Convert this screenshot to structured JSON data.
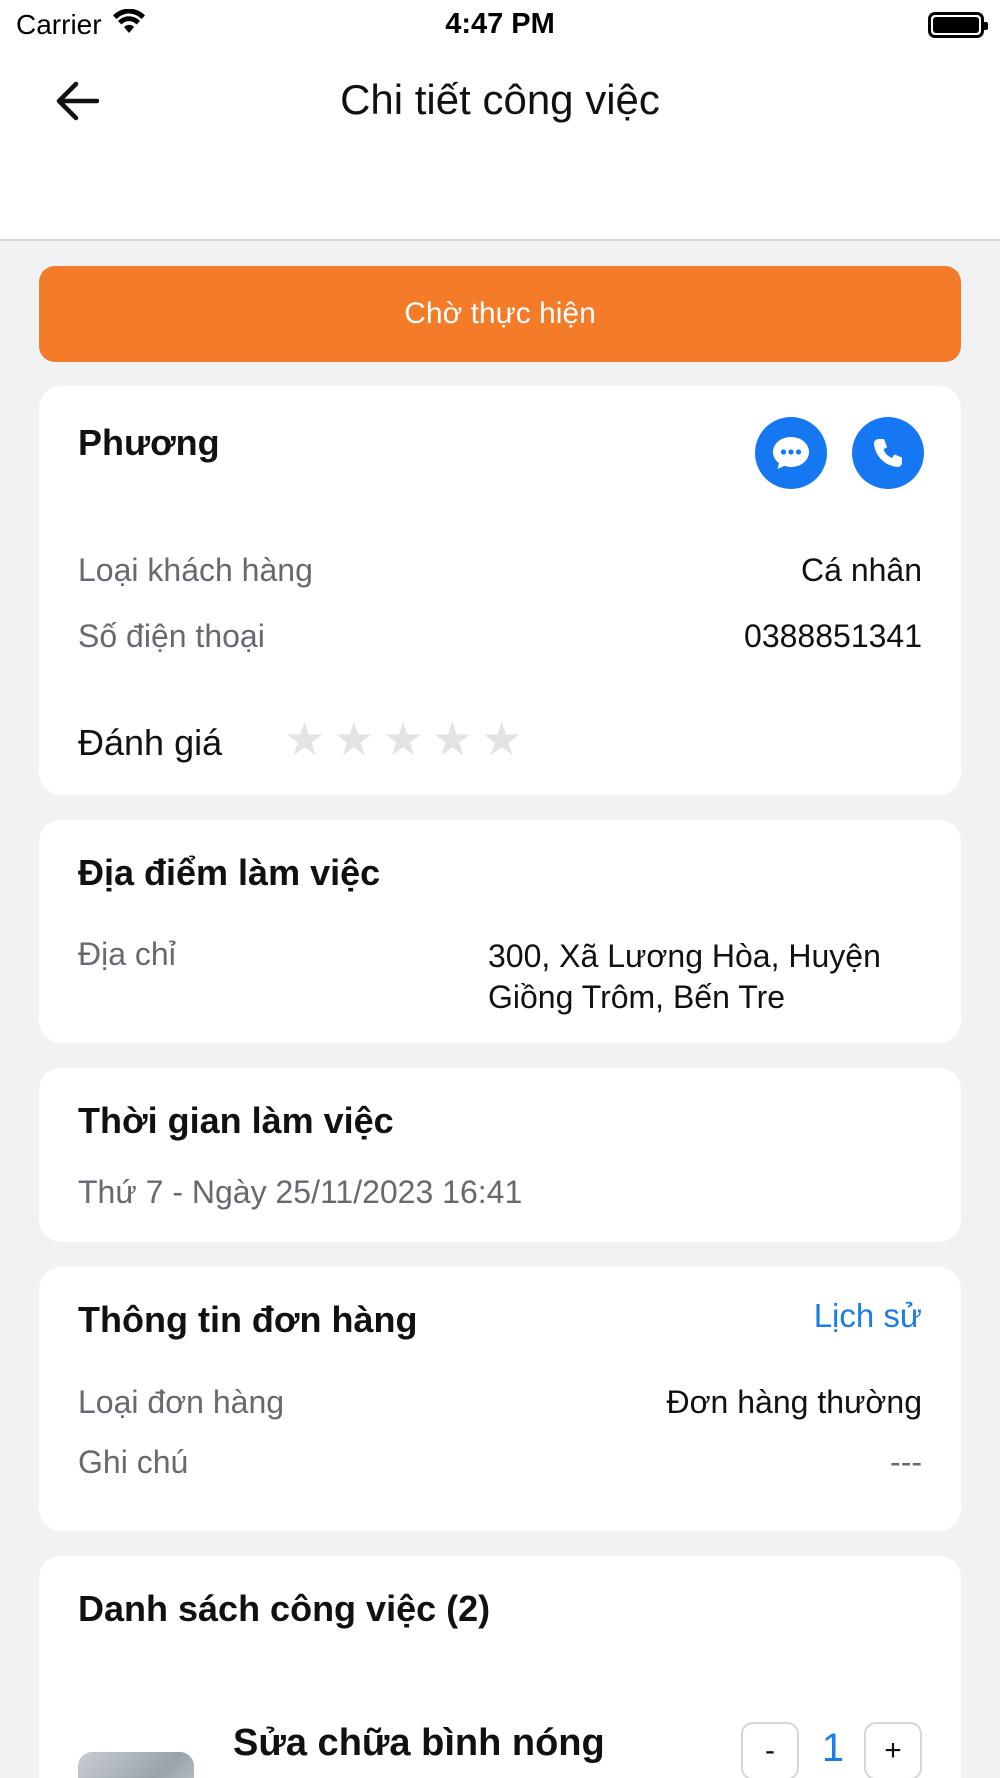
{
  "status_bar": {
    "carrier": "Carrier",
    "time": "4:47 PM"
  },
  "header": {
    "title": "Chi tiết công việc"
  },
  "status_banner": {
    "label": "Chờ thực hiện",
    "color": "#f47b28"
  },
  "customer": {
    "name": "Phương",
    "type_label": "Loại khách hàng",
    "type_value": "Cá nhân",
    "phone_label": "Số điện thoại",
    "phone_value": "0388851341",
    "rating_label": "Đánh giá",
    "rating_value": 0,
    "rating_max": 5
  },
  "location": {
    "title": "Địa điểm làm việc",
    "address_label": "Địa chỉ",
    "address_line1": "300, Xã Lương Hòa, Huyện",
    "address_line2": "Giồng Trôm, Bến Tre"
  },
  "schedule": {
    "title": "Thời gian làm việc",
    "datetime": "Thứ 7 - Ngày 25/11/2023 16:41"
  },
  "order": {
    "title": "Thông tin đơn hàng",
    "history_link": "Lịch sử",
    "type_label": "Loại đơn hàng",
    "type_value": "Đơn hàng thường",
    "note_label": "Ghi chú",
    "note_value": "---"
  },
  "jobs": {
    "title": "Danh sách công việc (2)",
    "items": [
      {
        "name": "Sửa chữa bình nóng",
        "quantity": "1",
        "minus": "-",
        "plus": "+"
      }
    ]
  },
  "colors": {
    "accent_orange": "#f47b28",
    "accent_blue": "#1677f2",
    "link_blue": "#1a7de8"
  }
}
